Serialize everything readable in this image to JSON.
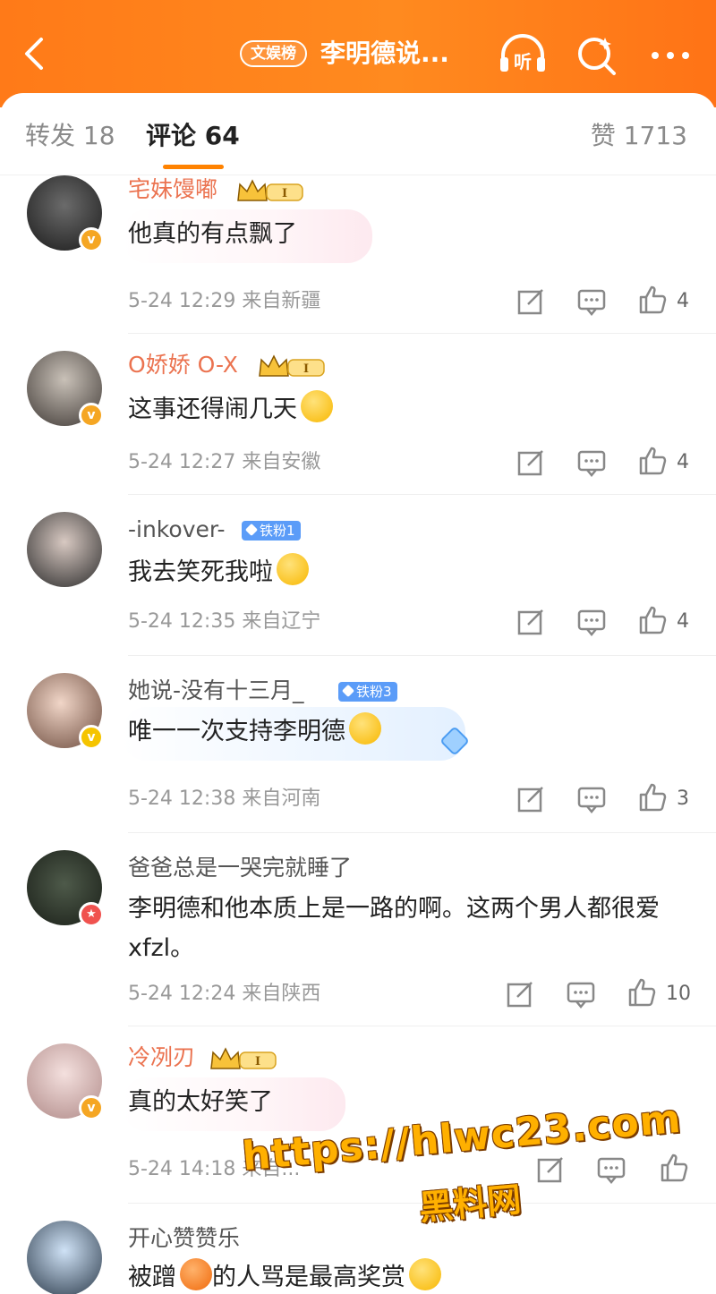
{
  "header": {
    "badge": "文娱榜",
    "title": "李明德说...",
    "icons": [
      "back-icon",
      "listen-icon",
      "search-icon",
      "more-icon"
    ],
    "listen_label": "听"
  },
  "tabs": {
    "repost": "转发 18",
    "comments": "评论 64",
    "likes": "赞 1713"
  },
  "colors": {
    "header_orange": "#ff7a18",
    "username_orange": "#eb7350",
    "accent": "#ff8200",
    "fan_blue": "#5b9cf8"
  },
  "comments": [
    {
      "user": "宅妹馒嘟",
      "badge": "crown-level-1",
      "badge_text": "I",
      "verified": "v-badge",
      "text": "他真的有点飘了",
      "time": "5-24 12:29",
      "location": "来自新疆",
      "likes": "4"
    },
    {
      "user": "O娇娇 O-X",
      "badge": "crown-level-1",
      "badge_text": "I",
      "verified": "v-badge",
      "text": "这事还得闹几天",
      "time": "5-24 12:27",
      "location": "来自安徽",
      "likes": "4"
    },
    {
      "user": "-inkover-",
      "fan_badge": "铁粉1",
      "text": "我去笑死我啦",
      "time": "5-24 12:35",
      "location": "来自辽宁",
      "likes": "4"
    },
    {
      "user": "她说-没有十三月_",
      "fan_badge": "铁粉3",
      "verified": "v-badge",
      "text": "唯一一次支持李明德",
      "time": "5-24 12:38",
      "location": "来自河南",
      "likes": "3"
    },
    {
      "user": "爸爸总是一哭完就睡了",
      "verified": "star-badge",
      "text": "李明德和他本质上是一路的啊。这两个男人都很爱 xfzl。",
      "time": "5-24 12:24",
      "location": "来自陕西",
      "likes": "10"
    },
    {
      "user": "冷冽刃",
      "badge": "crown-level-1",
      "badge_text": "I",
      "verified": "v-badge",
      "text": "真的太好笑了",
      "time": "5-24 14:18",
      "location": "来自...",
      "likes": ""
    },
    {
      "user": "开心赞赞乐",
      "text_a": "被蹭",
      "text_b": "的人骂是最高奖赏",
      "time": "",
      "location": "",
      "likes": ""
    }
  ],
  "watermark": {
    "url": "https://hlwc23.com",
    "label": "黑料网"
  }
}
